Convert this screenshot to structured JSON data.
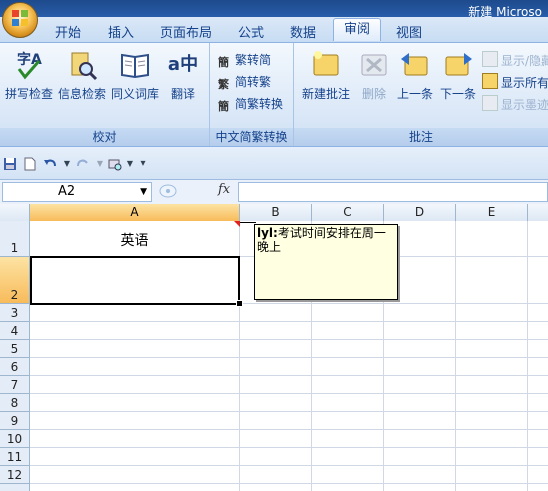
{
  "window": {
    "title": "新建 Microso"
  },
  "tabs": [
    {
      "label": "开始"
    },
    {
      "label": "插入"
    },
    {
      "label": "页面布局"
    },
    {
      "label": "公式"
    },
    {
      "label": "数据"
    },
    {
      "label": "审阅",
      "active": true
    },
    {
      "label": "视图"
    }
  ],
  "ribbon": {
    "proofing": {
      "label": "校对",
      "buttons": [
        "拼写检查",
        "信息检索",
        "同义词库",
        "翻译"
      ],
      "translate_glyph": "a中"
    },
    "chinese": {
      "label": "中文简繁转换",
      "buttons": [
        "繁转简",
        "简转繁",
        "简繁转换"
      ]
    },
    "comments": {
      "label": "批注",
      "buttons": [
        "新建批注",
        "删除",
        "上一条",
        "下一条"
      ],
      "side_buttons": [
        "显示/隐藏",
        "显示所有",
        "显示墨迹"
      ]
    }
  },
  "formula_bar": {
    "name_box": "A2",
    "fx_label": "fx",
    "formula": ""
  },
  "sheet": {
    "columns": [
      "A",
      "B",
      "C",
      "D",
      "E"
    ],
    "selected_column": "A",
    "rows": [
      "1",
      "2",
      "3",
      "4",
      "5",
      "6",
      "7",
      "8",
      "9",
      "10",
      "11",
      "12"
    ],
    "selected_row": "2",
    "a1_value": "英语",
    "comment": {
      "author": "lyl:",
      "text": "考试时间安排在周一晚上"
    }
  },
  "colors": {
    "accent": "#15428b",
    "selection": "#f8bb5b",
    "comment_bg": "#ffffe1"
  }
}
